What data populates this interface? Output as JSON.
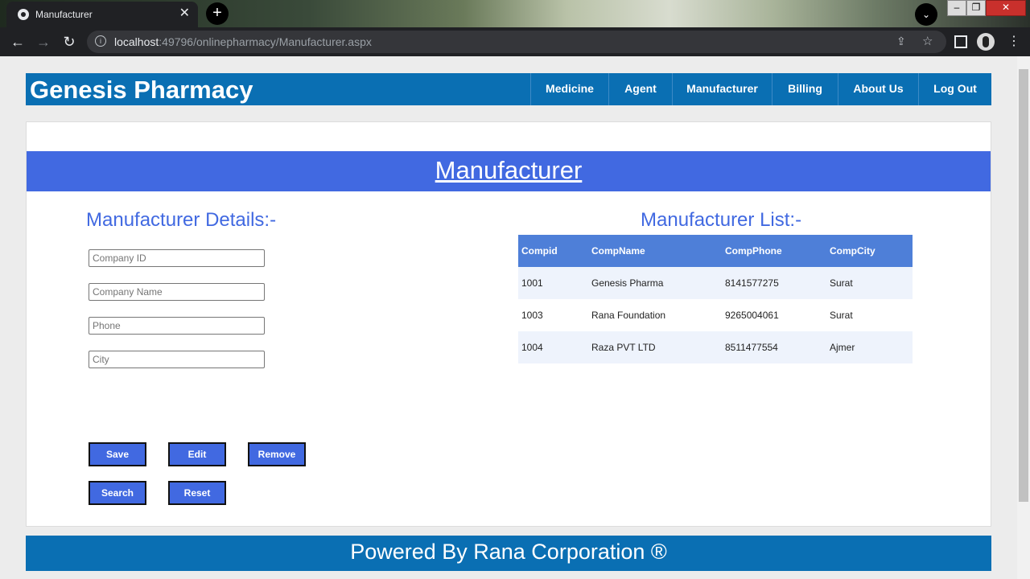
{
  "browser": {
    "tab_title": "Manufacturer",
    "tab_close": "✕",
    "new_tab": "+",
    "tab_dropdown": "⌄",
    "url_host": "localhost",
    "url_path": ":49796/onlinepharmacy/Manufacturer.aspx",
    "back": "←",
    "forward": "→",
    "reload": "↻",
    "menu": "⋮",
    "share": "⇪",
    "star": "☆",
    "min": "–",
    "max": "❐",
    "close": "✕"
  },
  "header": {
    "brand": "Genesis Pharmacy",
    "nav": [
      "Medicine",
      "Agent",
      "Manufacturer",
      "Billing",
      "About Us",
      "Log Out"
    ]
  },
  "page": {
    "banner_title": "Manufacturer",
    "details_title": "Manufacturer Details:-",
    "list_title": "Manufacturer List:-"
  },
  "form": {
    "company_id_placeholder": "Company ID",
    "company_name_placeholder": "Company Name",
    "phone_placeholder": "Phone",
    "city_placeholder": "City"
  },
  "buttons": {
    "save": "Save",
    "edit": "Edit",
    "remove": "Remove",
    "search": "Search",
    "reset": "Reset"
  },
  "table": {
    "headers": [
      "Compid",
      "CompName",
      "CompPhone",
      "CompCity"
    ],
    "rows": [
      [
        "1001",
        "Genesis Pharma",
        "8141577275",
        "Surat"
      ],
      [
        "1003",
        "Rana Foundation",
        "9265004061",
        "Surat"
      ],
      [
        "1004",
        "Raza PVT LTD",
        "8511477554",
        "Ajmer"
      ]
    ]
  },
  "footer": {
    "text": "Powered By Rana Corporation ®"
  },
  "colors": {
    "navbar": "#0a6fb3",
    "banner": "#4169e1",
    "button": "#4169e1",
    "table_header": "#4e7fd8"
  }
}
